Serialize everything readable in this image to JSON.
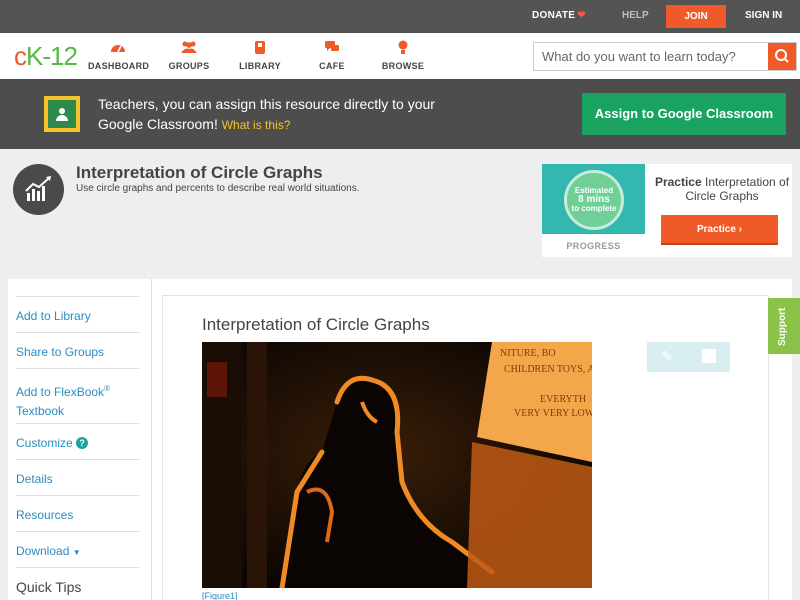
{
  "topbar": {
    "donate": "DONATE",
    "help": "HELP",
    "join": "JOIN",
    "sign_in": "SIGN IN"
  },
  "nav": {
    "logo_c": "c",
    "logo_k": "K",
    "logo_num": "-12",
    "items": [
      {
        "label": "DASHBOARD",
        "icon": "dashboard-icon"
      },
      {
        "label": "GROUPS",
        "icon": "groups-icon"
      },
      {
        "label": "LIBRARY",
        "icon": "library-icon"
      },
      {
        "label": "CAFE",
        "icon": "cafe-icon"
      },
      {
        "label": "BROWSE",
        "icon": "browse-icon"
      }
    ],
    "search_placeholder": "What do you want to learn today?"
  },
  "banner": {
    "text": "Teachers, you can assign this resource directly to your Google Classroom!",
    "what": "What is this?",
    "assign_label": "Assign to Google Classroom"
  },
  "concept": {
    "title": "Interpretation of Circle Graphs",
    "description": "Use circle graphs and percents to describe real world situations."
  },
  "progress": {
    "estimated": "Estimated",
    "mins": "8 mins",
    "to_complete": "to complete",
    "label": "PROGRESS",
    "practice_bold": "Practice",
    "practice_rest": "Interpretation of Circle Graphs",
    "practice_btn": "Practice"
  },
  "sidebar": {
    "add_library": "Add to Library",
    "share_groups": "Share to Groups",
    "add_flexbook": "Add to FlexBook",
    "reg": "®",
    "textbook": "Textbook",
    "customize": "Customize",
    "details": "Details",
    "resources": "Resources",
    "download": "Download",
    "quick_tips": "Quick Tips"
  },
  "article": {
    "title": "Interpretation of Circle Graphs",
    "figure": "[Figure1]"
  },
  "support": "Support",
  "colors": {
    "accent": "#f05a28",
    "green": "#1aa260",
    "link": "#2a8dc3"
  }
}
